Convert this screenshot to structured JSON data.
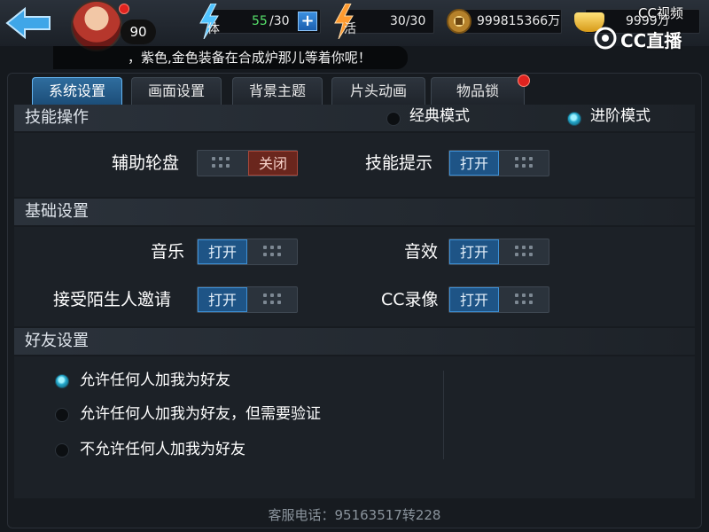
{
  "topbar": {
    "level": "90",
    "stamina_icon_label": "体",
    "stamina_current": "55",
    "stamina_max": "/30",
    "activity_icon_label": "活",
    "activity_value": "30/30",
    "coins": "999815366万",
    "gold": "9999万",
    "watermark_top": "CC视频",
    "watermark_main": "CC直播"
  },
  "ticker": {
    "text": "，紫色,金色装备在合成炉那儿等着你呢！"
  },
  "tabs": [
    {
      "label": "系统设置",
      "active": true
    },
    {
      "label": "画面设置",
      "active": false
    },
    {
      "label": "背景主题",
      "active": false
    },
    {
      "label": "片头动画",
      "active": false
    },
    {
      "label": "物品锁",
      "active": false
    }
  ],
  "skill_section": {
    "title": "技能操作",
    "mode_classic": "经典模式",
    "mode_advanced": "进阶模式",
    "selected_mode": "进阶模式",
    "assist_wheel_label": "辅助轮盘",
    "assist_wheel_state": "关闭",
    "skill_hint_label": "技能提示",
    "skill_hint_state": "打开"
  },
  "basic_section": {
    "title": "基础设置",
    "music_label": "音乐",
    "music_state": "打开",
    "sfx_label": "音效",
    "sfx_state": "打开",
    "stranger_label": "接受陌生人邀请",
    "stranger_state": "打开",
    "record_label": "CC录像",
    "record_state": "打开"
  },
  "friend_section": {
    "title": "好友设置",
    "options": [
      "允许任何人加我为好友",
      "允许任何人加我为好友，但需要验证",
      "不允许任何人加我为好友"
    ],
    "selected_index": 0
  },
  "footer": {
    "service_phone": "客服电话：95163517转228"
  },
  "colors": {
    "accent_on": "#1e5486",
    "accent_off": "#6a261d",
    "radio_selected": "#23a6c9"
  }
}
